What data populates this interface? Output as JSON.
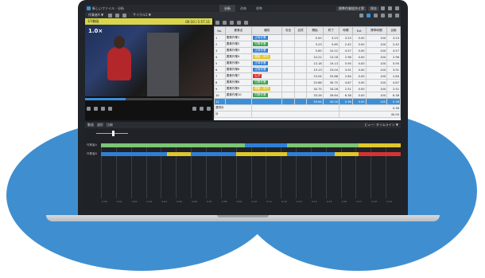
{
  "app": {
    "title": "新しいファイル - 分析",
    "tabs": [
      "分析",
      "改善",
      "標準"
    ],
    "active_tab": 0,
    "buttons": [
      "標準作業組合せ票",
      "保存"
    ]
  },
  "menubar": {
    "process_label": "作業者A ▼",
    "cycle_label": "サイクル1 ▼"
  },
  "video": {
    "header_left": "1/1動画",
    "header_right": "00:10 / 1:57.11",
    "speed": "1.0×",
    "progress": 0.32
  },
  "table": {
    "columns": [
      "No.",
      "要素名",
      "種別",
      "安全",
      "品質",
      "開始",
      "終了",
      "時間",
      "Ext",
      "標準時間",
      "比較"
    ],
    "rows": [
      [
        "1",
        "要素作業1",
        "正味作業",
        "",
        "",
        "0.00",
        "3.23",
        "3.23",
        "0.00",
        "100",
        "3.23"
      ],
      [
        "2",
        "要素作業2",
        "付帯作業",
        "",
        "",
        "3.23",
        "5.65",
        "2.42",
        "0.00",
        "100",
        "2.42"
      ],
      [
        "3",
        "要素作業3",
        "正味作業",
        "",
        "",
        "5.65",
        "10.22",
        "4.57",
        "0.00",
        "100",
        "4.57"
      ],
      [
        "4",
        "要素作業4",
        "移動・歩行",
        "",
        "",
        "10.22",
        "13.18",
        "2.96",
        "0.00",
        "100",
        "2.96"
      ],
      [
        "5",
        "要素作業5",
        "正味作業",
        "",
        "",
        "13.18",
        "19.13",
        "5.95",
        "0.00",
        "100",
        "5.95"
      ],
      [
        "6",
        "要素作業6",
        "正味作業",
        "",
        "",
        "19.13",
        "23.04",
        "3.91",
        "0.00",
        "100",
        "3.91"
      ],
      [
        "7",
        "要素作業7",
        "ムダ",
        "",
        "",
        "23.04",
        "25.88",
        "2.84",
        "0.00",
        "100",
        "2.84"
      ],
      [
        "8",
        "要素作業8",
        "付帯作業",
        "",
        "",
        "25.88",
        "30.75",
        "4.87",
        "0.00",
        "100",
        "4.87"
      ],
      [
        "9",
        "要素作業9",
        "移動・歩行",
        "",
        "",
        "30.75",
        "33.26",
        "2.51",
        "0.00",
        "100",
        "2.51"
      ],
      [
        "10",
        "要素作業10",
        "付帯作業",
        "",
        "",
        "33.26",
        "39.64",
        "6.38",
        "0.00",
        "100",
        "6.38"
      ],
      [
        "11",
        "",
        "",
        "",
        "",
        "39.64",
        "40.00",
        "0.36",
        "0.00",
        "100",
        "0.36"
      ]
    ],
    "selected_row": 10,
    "summary": [
      [
        "選択計",
        "",
        "0.36"
      ],
      [
        "計",
        "",
        "40.00"
      ]
    ],
    "tag_colors": {
      "正味作業": "#2f7fd6",
      "付帯作業": "#3aa34a",
      "移動・歩行": "#e0c72a",
      "ムダ": "#d83232"
    }
  },
  "timeline": {
    "tabs": [
      "動画",
      "波形",
      "比較"
    ],
    "view_label": "ビュー: タイムライン ▼",
    "tracks": [
      {
        "label": "作業者A",
        "segments": [
          [
            0,
            0.48,
            "#7cc576"
          ],
          [
            0.48,
            0.62,
            "#2f7fd6"
          ],
          [
            0.62,
            0.86,
            "#7cc576"
          ],
          [
            0.86,
            1,
            "#e0c72a"
          ]
        ]
      },
      {
        "label": "作業者B",
        "segments": [
          [
            0,
            0.22,
            "#2f7fd6"
          ],
          [
            0.22,
            0.3,
            "#e0c72a"
          ],
          [
            0.3,
            0.45,
            "#2f7fd6"
          ],
          [
            0.45,
            0.62,
            "#e0c72a"
          ],
          [
            0.62,
            0.78,
            "#2f7fd6"
          ],
          [
            0.78,
            0.86,
            "#e0c72a"
          ],
          [
            0.86,
            1,
            "#d83232"
          ]
        ]
      }
    ],
    "ticks": [
      "0:00",
      "0:01",
      "0:02",
      "0:03",
      "0:04",
      "0:05",
      "0:06",
      "0:07",
      "0:08",
      "0:09",
      "0:10",
      "0:11",
      "0:12",
      "0:13",
      "0:14",
      "0:15",
      "0:16",
      "0:17",
      "0:18",
      "0:19"
    ]
  }
}
